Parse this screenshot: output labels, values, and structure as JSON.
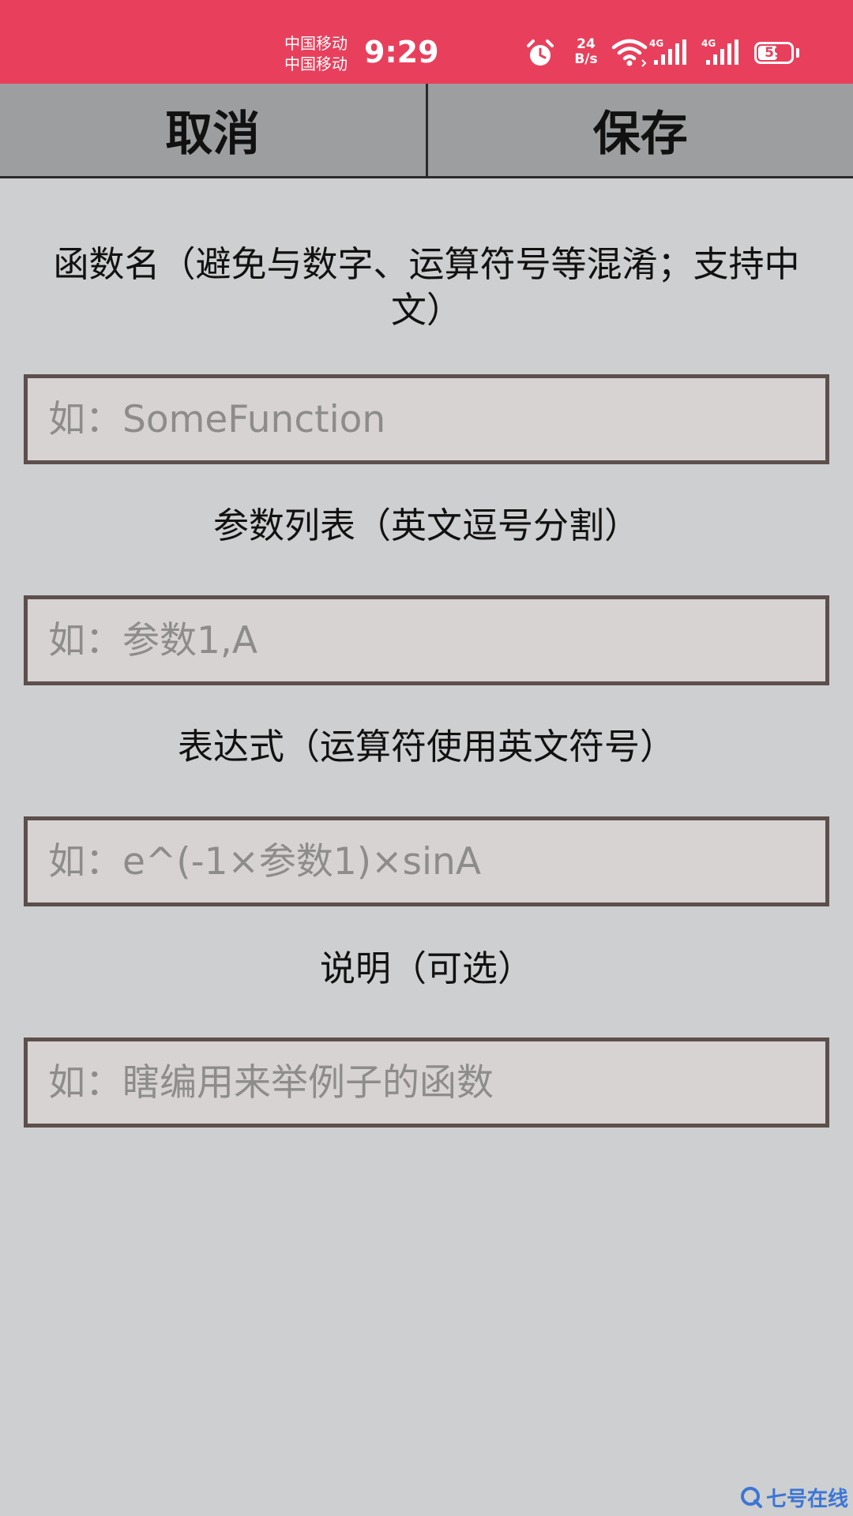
{
  "status_bar": {
    "carrier_1": "中国移动",
    "carrier_2": "中国移动",
    "time": "9:29",
    "net_speed_value": "24",
    "net_speed_unit": "B/s",
    "signal_1_label": "4G",
    "signal_2_label": "4G",
    "battery_level": "59",
    "icons": [
      "alarm-icon",
      "wifi-icon",
      "signal-icon",
      "battery-icon"
    ],
    "background_color": "#e8405c"
  },
  "toolbar": {
    "cancel_label": "取消",
    "save_label": "保存"
  },
  "form": {
    "function_name": {
      "label": "函数名（避免与数字、运算符号等混淆；支持中文）",
      "placeholder": "如：SomeFunction",
      "value": ""
    },
    "parameters": {
      "label": "参数列表（英文逗号分割）",
      "placeholder": "如：参数1,A",
      "value": ""
    },
    "expression": {
      "label": "表达式（运算符使用英文符号）",
      "placeholder": "如：e^(-1×参数1)×sinA",
      "value": ""
    },
    "description": {
      "label": "说明（可选）",
      "placeholder": "如：瞎编用来举例子的函数",
      "value": ""
    }
  },
  "watermark": {
    "text": "七号在线"
  }
}
